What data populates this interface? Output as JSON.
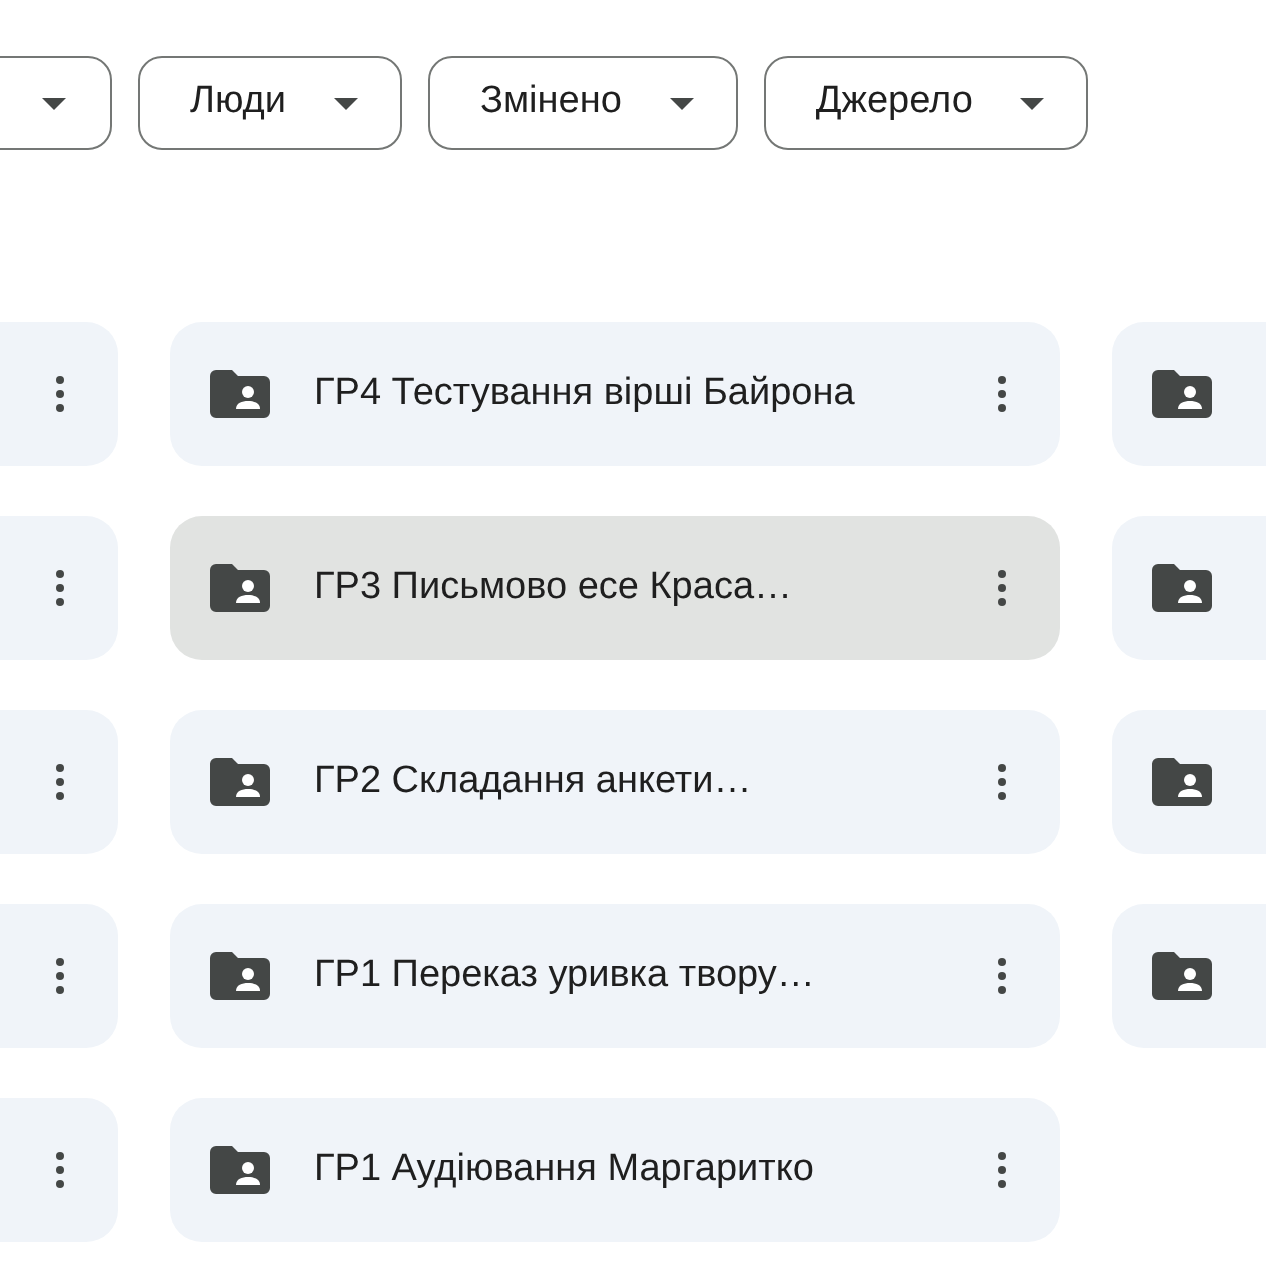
{
  "filters": [
    {
      "label": "Люди"
    },
    {
      "label": "Змінено"
    },
    {
      "label": "Джерело"
    }
  ],
  "folder_grid": {
    "left_column": [
      {
        "selected": false
      },
      {
        "selected": false
      },
      {
        "selected": false
      },
      {
        "selected": false
      },
      {
        "selected": false
      }
    ],
    "middle_column": [
      {
        "name": "ГР4 Тестування вірші Байрона",
        "selected": false
      },
      {
        "name": "ГР3 Письмово есе Краса…",
        "selected": true
      },
      {
        "name": "ГР2 Складання анкети…",
        "selected": false
      },
      {
        "name": "ГР1 Переказ уривка твору…",
        "selected": false
      },
      {
        "name": "ГР1 Аудіювання Маргаритко",
        "selected": false
      }
    ],
    "right_column": [
      {
        "selected": false
      },
      {
        "selected": false
      },
      {
        "selected": false
      },
      {
        "selected": false
      }
    ]
  }
}
